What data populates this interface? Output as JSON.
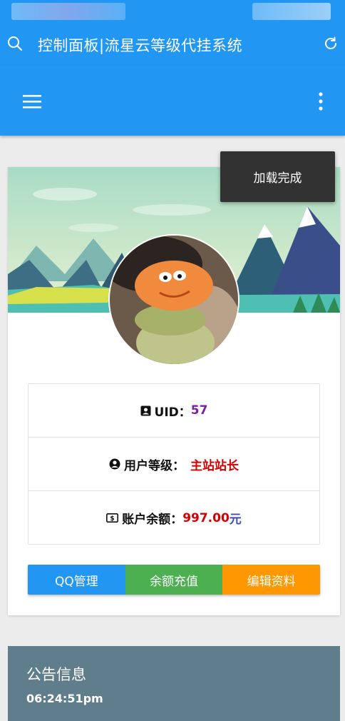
{
  "browser": {
    "title": "控制面板|流星云等级代挂系统"
  },
  "toast": {
    "text": "加载完成"
  },
  "user": {
    "uid_label": "UID：",
    "uid_value": "57",
    "level_label": "用户等级：",
    "level_value": "主站站长",
    "balance_label": "账户余额：",
    "balance_amount": "997.00",
    "balance_unit": "元"
  },
  "actions": {
    "qq_manage": "QQ管理",
    "recharge": "余额充值",
    "edit_profile": "编辑资料"
  },
  "notice": {
    "title": "公告信息",
    "time": "06:24:51pm"
  },
  "colors": {
    "primary": "#2196f3",
    "success": "#4caf50",
    "warning": "#ff9800",
    "notice_bg": "#607d8b"
  }
}
